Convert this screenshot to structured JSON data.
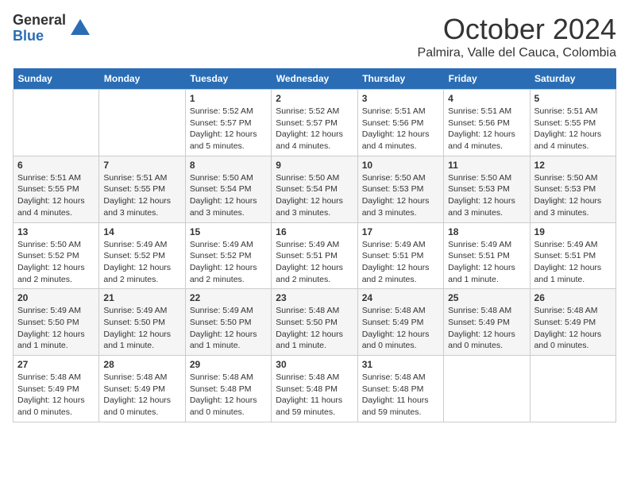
{
  "logo": {
    "general": "General",
    "blue": "Blue"
  },
  "title": "October 2024",
  "location": "Palmira, Valle del Cauca, Colombia",
  "days_of_week": [
    "Sunday",
    "Monday",
    "Tuesday",
    "Wednesday",
    "Thursday",
    "Friday",
    "Saturday"
  ],
  "weeks": [
    [
      {
        "day": "",
        "details": ""
      },
      {
        "day": "",
        "details": ""
      },
      {
        "day": "1",
        "details": "Sunrise: 5:52 AM\nSunset: 5:57 PM\nDaylight: 12 hours and 5 minutes."
      },
      {
        "day": "2",
        "details": "Sunrise: 5:52 AM\nSunset: 5:57 PM\nDaylight: 12 hours and 4 minutes."
      },
      {
        "day": "3",
        "details": "Sunrise: 5:51 AM\nSunset: 5:56 PM\nDaylight: 12 hours and 4 minutes."
      },
      {
        "day": "4",
        "details": "Sunrise: 5:51 AM\nSunset: 5:56 PM\nDaylight: 12 hours and 4 minutes."
      },
      {
        "day": "5",
        "details": "Sunrise: 5:51 AM\nSunset: 5:55 PM\nDaylight: 12 hours and 4 minutes."
      }
    ],
    [
      {
        "day": "6",
        "details": "Sunrise: 5:51 AM\nSunset: 5:55 PM\nDaylight: 12 hours and 4 minutes."
      },
      {
        "day": "7",
        "details": "Sunrise: 5:51 AM\nSunset: 5:55 PM\nDaylight: 12 hours and 3 minutes."
      },
      {
        "day": "8",
        "details": "Sunrise: 5:50 AM\nSunset: 5:54 PM\nDaylight: 12 hours and 3 minutes."
      },
      {
        "day": "9",
        "details": "Sunrise: 5:50 AM\nSunset: 5:54 PM\nDaylight: 12 hours and 3 minutes."
      },
      {
        "day": "10",
        "details": "Sunrise: 5:50 AM\nSunset: 5:53 PM\nDaylight: 12 hours and 3 minutes."
      },
      {
        "day": "11",
        "details": "Sunrise: 5:50 AM\nSunset: 5:53 PM\nDaylight: 12 hours and 3 minutes."
      },
      {
        "day": "12",
        "details": "Sunrise: 5:50 AM\nSunset: 5:53 PM\nDaylight: 12 hours and 3 minutes."
      }
    ],
    [
      {
        "day": "13",
        "details": "Sunrise: 5:50 AM\nSunset: 5:52 PM\nDaylight: 12 hours and 2 minutes."
      },
      {
        "day": "14",
        "details": "Sunrise: 5:49 AM\nSunset: 5:52 PM\nDaylight: 12 hours and 2 minutes."
      },
      {
        "day": "15",
        "details": "Sunrise: 5:49 AM\nSunset: 5:52 PM\nDaylight: 12 hours and 2 minutes."
      },
      {
        "day": "16",
        "details": "Sunrise: 5:49 AM\nSunset: 5:51 PM\nDaylight: 12 hours and 2 minutes."
      },
      {
        "day": "17",
        "details": "Sunrise: 5:49 AM\nSunset: 5:51 PM\nDaylight: 12 hours and 2 minutes."
      },
      {
        "day": "18",
        "details": "Sunrise: 5:49 AM\nSunset: 5:51 PM\nDaylight: 12 hours and 1 minute."
      },
      {
        "day": "19",
        "details": "Sunrise: 5:49 AM\nSunset: 5:51 PM\nDaylight: 12 hours and 1 minute."
      }
    ],
    [
      {
        "day": "20",
        "details": "Sunrise: 5:49 AM\nSunset: 5:50 PM\nDaylight: 12 hours and 1 minute."
      },
      {
        "day": "21",
        "details": "Sunrise: 5:49 AM\nSunset: 5:50 PM\nDaylight: 12 hours and 1 minute."
      },
      {
        "day": "22",
        "details": "Sunrise: 5:49 AM\nSunset: 5:50 PM\nDaylight: 12 hours and 1 minute."
      },
      {
        "day": "23",
        "details": "Sunrise: 5:48 AM\nSunset: 5:50 PM\nDaylight: 12 hours and 1 minute."
      },
      {
        "day": "24",
        "details": "Sunrise: 5:48 AM\nSunset: 5:49 PM\nDaylight: 12 hours and 0 minutes."
      },
      {
        "day": "25",
        "details": "Sunrise: 5:48 AM\nSunset: 5:49 PM\nDaylight: 12 hours and 0 minutes."
      },
      {
        "day": "26",
        "details": "Sunrise: 5:48 AM\nSunset: 5:49 PM\nDaylight: 12 hours and 0 minutes."
      }
    ],
    [
      {
        "day": "27",
        "details": "Sunrise: 5:48 AM\nSunset: 5:49 PM\nDaylight: 12 hours and 0 minutes."
      },
      {
        "day": "28",
        "details": "Sunrise: 5:48 AM\nSunset: 5:49 PM\nDaylight: 12 hours and 0 minutes."
      },
      {
        "day": "29",
        "details": "Sunrise: 5:48 AM\nSunset: 5:48 PM\nDaylight: 12 hours and 0 minutes."
      },
      {
        "day": "30",
        "details": "Sunrise: 5:48 AM\nSunset: 5:48 PM\nDaylight: 11 hours and 59 minutes."
      },
      {
        "day": "31",
        "details": "Sunrise: 5:48 AM\nSunset: 5:48 PM\nDaylight: 11 hours and 59 minutes."
      },
      {
        "day": "",
        "details": ""
      },
      {
        "day": "",
        "details": ""
      }
    ]
  ]
}
